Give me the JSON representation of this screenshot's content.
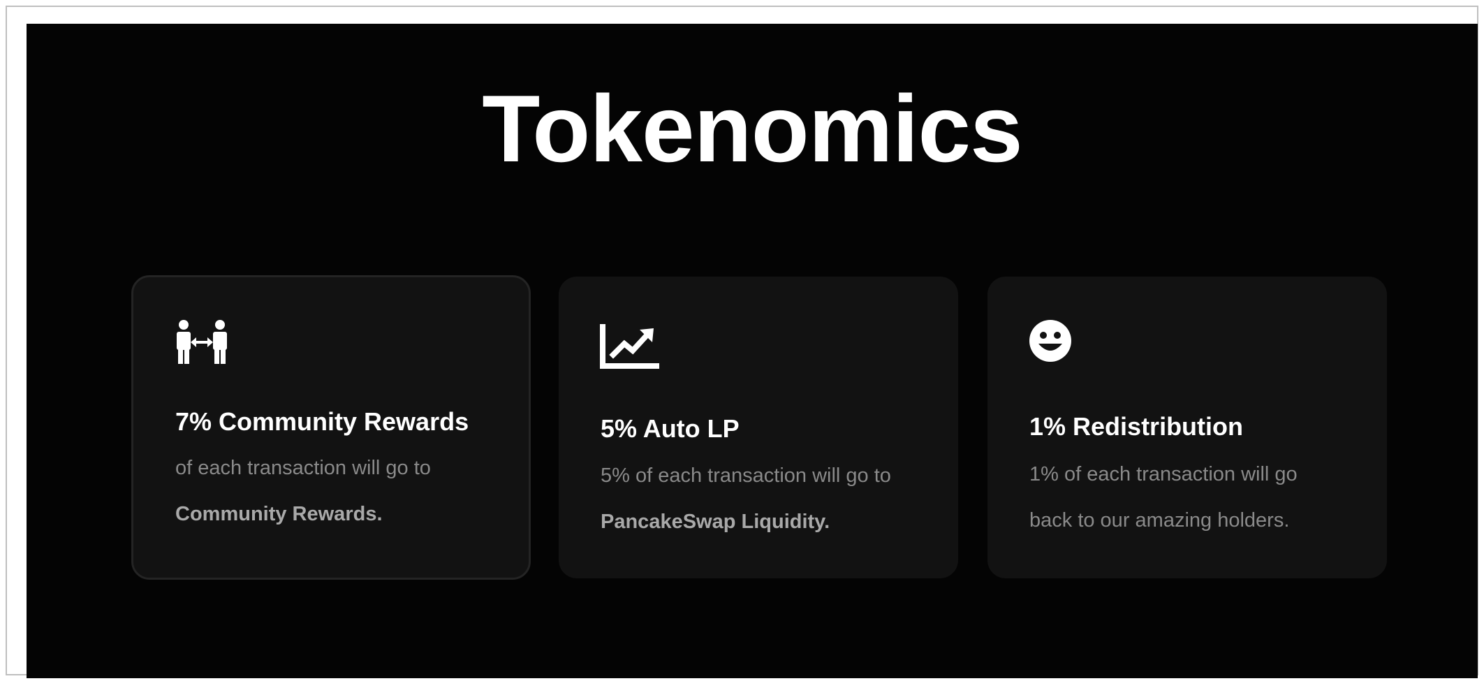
{
  "page": {
    "title": "Tokenomics"
  },
  "cards": [
    {
      "icon": "people-exchange-icon",
      "heading": "7% Community Rewards",
      "desc_prefix": "of each transaction will go to",
      "desc_emphasis": "Community Rewards."
    },
    {
      "icon": "chart-line-up-icon",
      "heading": "5% Auto LP",
      "desc_prefix": "5% of each transaction will go to",
      "desc_emphasis": "PancakeSwap Liquidity."
    },
    {
      "icon": "smiley-face-icon",
      "heading": "1% Redistribution",
      "desc_prefix": "1% of each transaction will go back to our amazing holders.",
      "desc_emphasis": ""
    }
  ],
  "colors": {
    "background": "#040404",
    "card": "#121212",
    "heading": "#ffffff",
    "body_text": "#8a8a8a",
    "emphasis_text": "#a9a9a9"
  }
}
